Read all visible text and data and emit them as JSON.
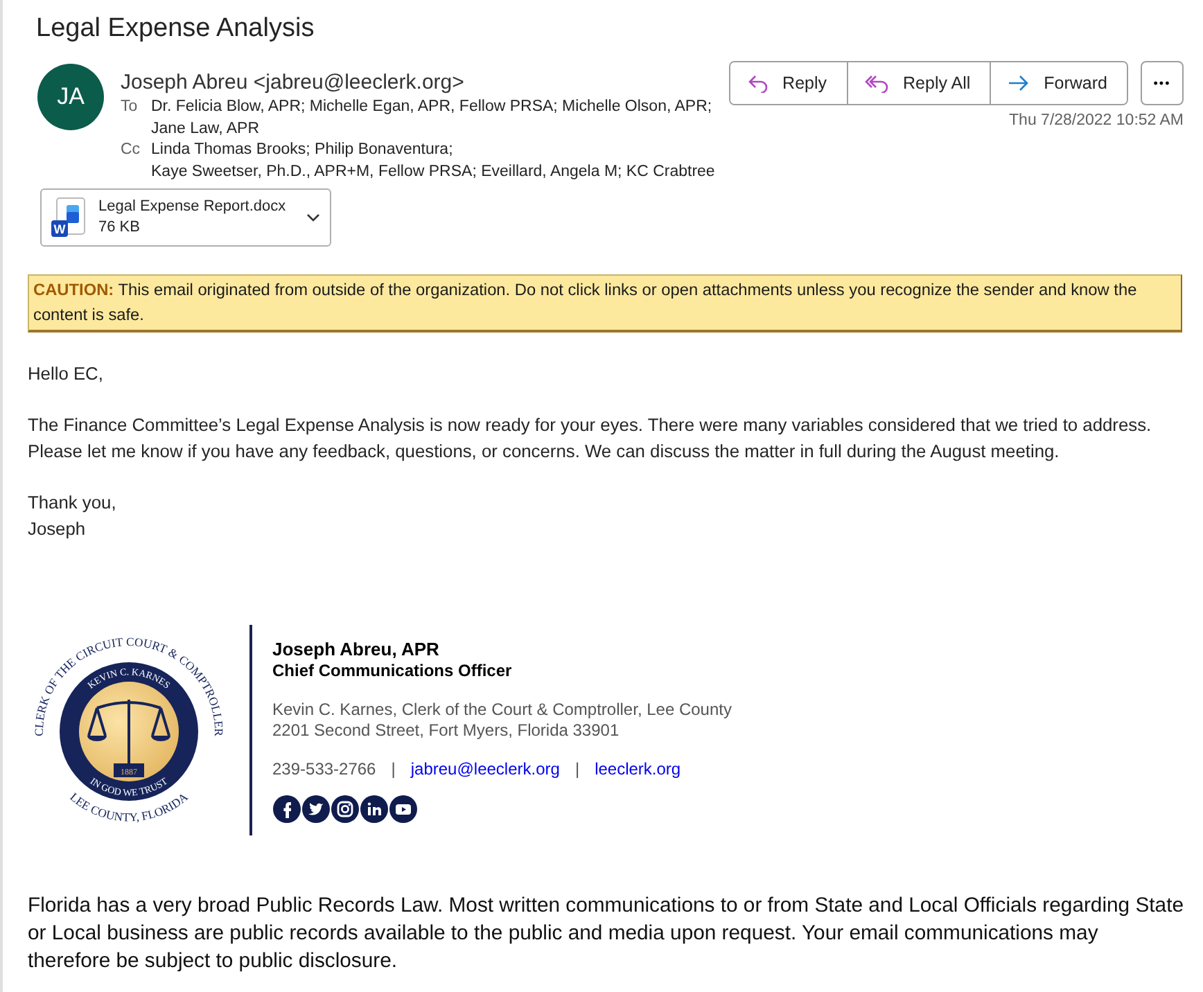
{
  "subject": "Legal Expense Analysis",
  "sender": {
    "initials": "JA",
    "name": "Joseph Abreu <jabreu@leeclerk.org>"
  },
  "recipients": [
    {
      "label": "To",
      "lines": [
        "Dr. Felicia Blow, APR; Michelle Egan, APR, Fellow PRSA; Michelle Olson, APR;",
        "Jane Law, APR"
      ]
    },
    {
      "label": "Cc",
      "lines": [
        "Linda Thomas Brooks; Philip Bonaventura;",
        "Kaye Sweetser, Ph.D., APR+M, Fellow PRSA; Eveillard, Angela M; KC Crabtree"
      ]
    }
  ],
  "attachment": {
    "name": "Legal Expense Report.docx",
    "size": "76 KB",
    "badge": "W"
  },
  "actions": [
    {
      "kind": "reply",
      "label": "Reply"
    },
    {
      "kind": "reply_all",
      "label": "Reply All"
    },
    {
      "kind": "forward",
      "label": "Forward"
    }
  ],
  "more": "•••",
  "date": "Thu 7/28/2022 10:52 AM",
  "caution": "**CAUTION:** This email originated from outside of the organization. Do not click links or open attachments unless you recognize the sender and know the content is safe.",
  "body": [
    "Hello EC,",
    "The Finance Committee’s Legal Expense Analysis is now ready for your eyes. There were many variables considered that we tried to address. Please let me know if you have any feedback, questions, or concerns. We can discuss the matter in full during the August meeting.",
    [
      "Thank you,",
      "Joseph"
    ]
  ],
  "seal": {
    "outer_top": "CLERK OF THE CIRCUIT COURT & COMPTROLLER",
    "inner_top": "KEVIN C. KARNES",
    "inner_bottom": "IN GOD WE TRUST",
    "outer_bottom": "LEE COUNTY, FLORIDA",
    "year": "1887"
  },
  "signature": {
    "name": "Joseph Abreu, APR",
    "title": "Chief Communications Officer",
    "org": "Kevin C. Karnes, Clerk of the Court & Comptroller, Lee County",
    "address": "2201 Second Street, Fort Myers, Florida 33901",
    "phone": "239-533-2766",
    "separators": [
      "|",
      "|"
    ],
    "email": "jabreu@leeclerk.org",
    "website": "leeclerk.org",
    "social": [
      {
        "kind": "facebook"
      },
      {
        "kind": "twitter"
      },
      {
        "kind": "instagram"
      },
      {
        "kind": "linkedin"
      },
      {
        "kind": "youtube"
      }
    ]
  },
  "footer": "Florida has a very broad Public Records Law. Most written communications to or from State and Local Officials regarding State or Local business are public records available to the public and media upon request. Your email communications may therefore be subject to public disclosure."
}
